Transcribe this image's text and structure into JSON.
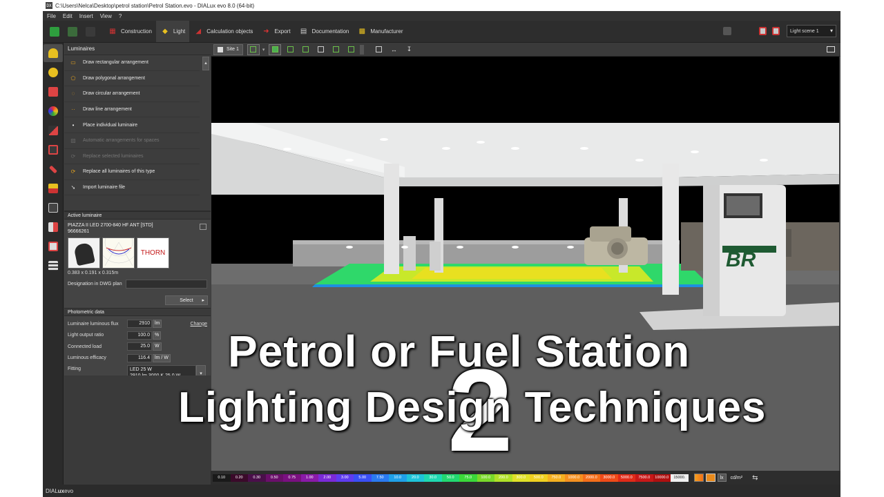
{
  "window": {
    "title": "C:\\Users\\Nelca\\Desktop\\petrol station\\Petrol Station.evo - DIALux evo 8.0  (64-bit)",
    "app_icon": "DX"
  },
  "menu": [
    "File",
    "Edit",
    "Insert",
    "View",
    "?"
  ],
  "toolbar": {
    "items": [
      {
        "label": "Construction",
        "icon": "construction-icon"
      },
      {
        "label": "Light",
        "icon": "light-icon"
      },
      {
        "label": "Calculation objects",
        "icon": "calculation-icon"
      },
      {
        "label": "Export",
        "icon": "export-icon"
      },
      {
        "label": "Documentation",
        "icon": "documentation-icon"
      },
      {
        "label": "Manufacturer",
        "icon": "manufacturer-icon"
      }
    ],
    "active": "Light",
    "scene_select": "Light scene 1"
  },
  "luminaires": {
    "heading": "Luminaires",
    "items": [
      {
        "label": "Draw rectangular arrangement",
        "enabled": true
      },
      {
        "label": "Draw polygonal arrangement",
        "enabled": true
      },
      {
        "label": "Draw circular arrangement",
        "enabled": true
      },
      {
        "label": "Draw line arrangement",
        "enabled": true
      },
      {
        "label": "Place individual luminaire",
        "enabled": true
      },
      {
        "label": "Automatic arrangements for spaces",
        "enabled": false
      },
      {
        "label": "Replace selected luminaires",
        "enabled": false
      },
      {
        "label": "Replace all luminaires of this type",
        "enabled": true
      },
      {
        "label": "Import luminaire file",
        "enabled": true
      }
    ]
  },
  "active_luminaire": {
    "heading": "Active luminaire",
    "name": "PIAZZA II LED 2700-840 HF ANT [STD]",
    "code": "96666261",
    "brand": "THORN",
    "dimensions": "0.383 x 0.191 x 0.315m",
    "dwg_label": "Designation in DWG plan",
    "dwg_value": "",
    "select_label": "Select"
  },
  "photometric": {
    "heading": "Photometric data",
    "change_label": "Change",
    "rows": [
      {
        "label": "Luminaire luminous flux",
        "value": "2910",
        "unit": "lm"
      },
      {
        "label": "Light output ratio",
        "value": "100.0",
        "unit": "%"
      },
      {
        "label": "Connected load",
        "value": "25.0",
        "unit": "W"
      },
      {
        "label": "Luminous efficacy",
        "value": "116.4",
        "unit": "lm / W"
      }
    ],
    "fitting_label": "Fitting",
    "fitting_line1": "LED 25 W",
    "fitting_line2": "2910 lm    3000 K    25.0 W"
  },
  "viewport": {
    "site_label": "Site 1",
    "sign_text": "BR"
  },
  "overlay": {
    "line1": "Petrol or Fuel Station",
    "line2": "Lighting Design Techniques",
    "number": "2"
  },
  "scale": {
    "values": [
      "0.10",
      "0.20",
      "0.30",
      "0.50",
      "0.75",
      "1.00",
      "2.00",
      "3.00",
      "5.00",
      "7.50",
      "10.0",
      "20.0",
      "30.0",
      "50.0",
      "75.0",
      "100.0",
      "200.0",
      "300.0",
      "500.0",
      "750.0",
      "1000.0",
      "2000.0",
      "3000.0",
      "5000.0",
      "7500.0",
      "10000.0",
      "15000."
    ],
    "colors": [
      "#1a1a1a",
      "#3b0a2a",
      "#4a0f4a",
      "#6a0f6a",
      "#7a1080",
      "#8a1aa8",
      "#7b2ad8",
      "#5f3cf0",
      "#3a4ff5",
      "#2a7af0",
      "#1fa0e8",
      "#1ec3d8",
      "#1fd8b0",
      "#22d870",
      "#3bd83a",
      "#7ad82a",
      "#b0e028",
      "#e0e028",
      "#f0d020",
      "#f5b020",
      "#f59020",
      "#f56e1a",
      "#f04a18",
      "#e02a18",
      "#c81818",
      "#b01010",
      "#f0f0f0"
    ],
    "unit_lx": "lx",
    "unit_cd": "cd/m²"
  },
  "status": {
    "brand_left": "DIAL",
    "brand_mid": "ux",
    "brand_right": "evo"
  }
}
